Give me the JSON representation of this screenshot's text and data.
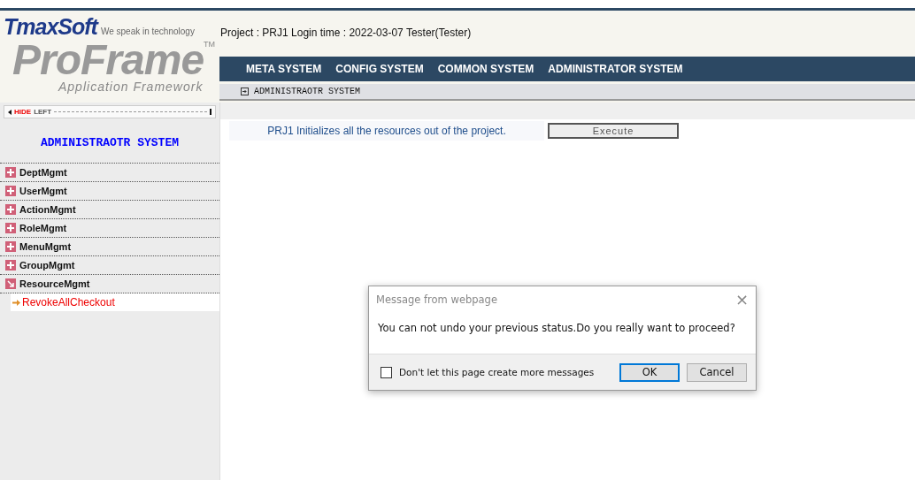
{
  "logo": {
    "brand": "TmaxSoft",
    "tagline": "We speak in technology",
    "product": "ProFrame",
    "trademark": "TM",
    "subtitle": "Application Framework"
  },
  "header": {
    "info": "Project : PRJ1 Login time : 2022-03-07 Tester(Tester)"
  },
  "nav": [
    {
      "label": "META SYSTEM",
      "selected": false
    },
    {
      "label": "CONFIG SYSTEM",
      "selected": false
    },
    {
      "label": "COMMON SYSTEM",
      "selected": false
    },
    {
      "label": "ADMINISTRATOR SYSTEM",
      "selected": false
    }
  ],
  "breadcrumb": "ADMINISTRAOTR SYSTEM",
  "sidebar": {
    "toggle": {
      "hide": "HIDE",
      "left": "LEFT"
    },
    "title": "ADMINISTRAOTR SYSTEM",
    "items": [
      {
        "label": "DeptMgmt",
        "expanded": false
      },
      {
        "label": "UserMgmt",
        "expanded": false
      },
      {
        "label": "ActionMgmt",
        "expanded": false
      },
      {
        "label": "RoleMgmt",
        "expanded": false
      },
      {
        "label": "MenuMgmt",
        "expanded": false
      },
      {
        "label": "GroupMgmt",
        "expanded": false
      },
      {
        "label": "ResourceMgmt",
        "expanded": true,
        "children": [
          {
            "label": "RevokeAllCheckout",
            "selected": true
          }
        ]
      }
    ]
  },
  "content": {
    "description": "PRJ1 Initializes all the resources out of the project.",
    "button": "Execute"
  },
  "dialog": {
    "title": "Message from webpage",
    "close": "×",
    "message": "You can not undo your previous status.Do you really want to proceed?",
    "checkbox": {
      "label": "Don't let this page create more messages",
      "checked": false
    },
    "buttons": [
      {
        "label": "OK",
        "selected": true
      },
      {
        "label": "Cancel",
        "selected": false
      }
    ]
  }
}
